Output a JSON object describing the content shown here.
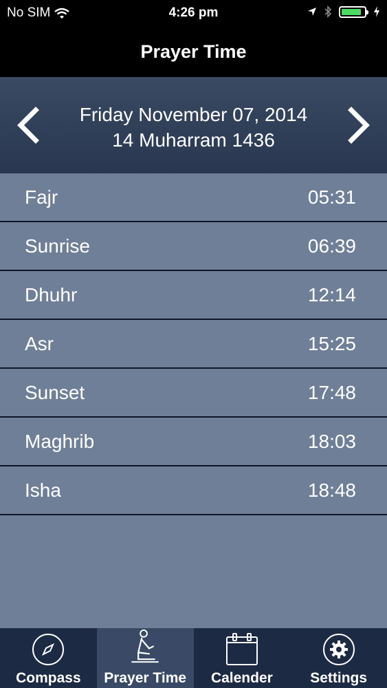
{
  "status_bar": {
    "carrier": "No SIM",
    "time": "4:26 pm",
    "battery_level": 0.9,
    "battery_color": "#4cd964"
  },
  "nav": {
    "title": "Prayer Time"
  },
  "date": {
    "gregorian": "Friday November 07, 2014",
    "hijri": "14 Muharram 1436",
    "prev_icon": "chevron-left-icon",
    "next_icon": "chevron-right-icon"
  },
  "prayers": [
    {
      "name": "Fajr",
      "time": "05:31"
    },
    {
      "name": "Sunrise",
      "time": "06:39"
    },
    {
      "name": "Dhuhr",
      "time": "12:14"
    },
    {
      "name": "Asr",
      "time": "15:25"
    },
    {
      "name": "Sunset",
      "time": "17:48"
    },
    {
      "name": "Maghrib",
      "time": "18:03"
    },
    {
      "name": "Isha",
      "time": "18:48"
    }
  ],
  "tabs": [
    {
      "label": "Compass",
      "icon": "compass-icon",
      "active": false
    },
    {
      "label": "Prayer Time",
      "icon": "praying-person-icon",
      "active": true
    },
    {
      "label": "Calender",
      "icon": "calendar-icon",
      "active": false
    },
    {
      "label": "Settings",
      "icon": "gear-icon",
      "active": false
    }
  ],
  "colors": {
    "list_bg": "#6f7f97",
    "header_bg": "#293750",
    "tab_bar_bg": "#1d2a43",
    "active_tab_bg": "#3a4a66"
  }
}
